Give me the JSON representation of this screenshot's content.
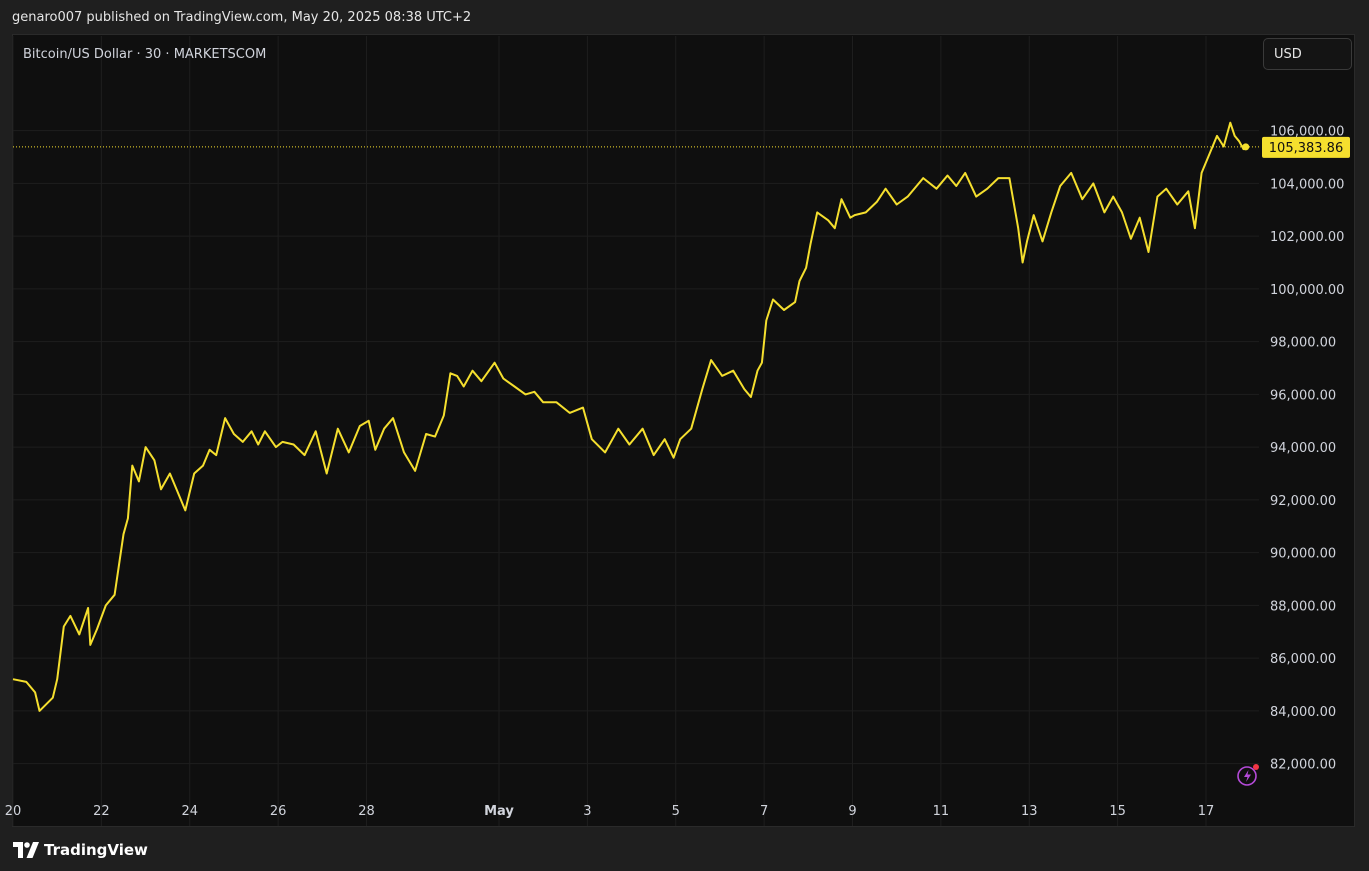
{
  "header": {
    "publish_line": "genaro007 published on TradingView.com, May 20, 2025 08:38 UTC+2"
  },
  "chart_header": {
    "symbol_line": "Bitcoin/US Dollar · 30 · MARKETSCOM"
  },
  "currency_button": {
    "label": "USD"
  },
  "footer": {
    "logo_text": "TradingView"
  },
  "colors": {
    "line": "#f5df2e",
    "background": "#0f0f0f",
    "grid": "#1e1e1e",
    "axis_text": "#d1d4dc"
  },
  "chart_data": {
    "type": "line",
    "title": "Bitcoin/US Dollar · 30 · MARKETSCOM",
    "xlabel": "",
    "ylabel": "",
    "grid": true,
    "x_tick_labels": [
      "20",
      "22",
      "24",
      "26",
      "28",
      "May",
      "3",
      "5",
      "7",
      "9",
      "11",
      "13",
      "15",
      "17"
    ],
    "x_tick_days": [
      20,
      22,
      24,
      26,
      28,
      31,
      33,
      35,
      37,
      39,
      41,
      43,
      45,
      47
    ],
    "y_tick_labels": [
      "82,000.00",
      "84,000.00",
      "86,000.00",
      "88,000.00",
      "90,000.00",
      "92,000.00",
      "94,000.00",
      "96,000.00",
      "98,000.00",
      "100,000.00",
      "102,000.00",
      "104,000.00",
      "106,000.00"
    ],
    "y_ticks": [
      82000,
      84000,
      86000,
      88000,
      90000,
      92000,
      94000,
      96000,
      98000,
      100000,
      102000,
      104000,
      106000
    ],
    "xlim": [
      20,
      48.2
    ],
    "ylim": [
      81000,
      108300
    ],
    "last_price": 105383.86,
    "last_price_label": "105,383.86",
    "series": [
      {
        "x": [
          20,
          20.3,
          20.5,
          20.6,
          20.9,
          21.0,
          21.15,
          21.3,
          21.5,
          21.7,
          21.75,
          21.9,
          22.1,
          22.3,
          22.5,
          22.6,
          22.7,
          22.85,
          23.0,
          23.2,
          23.35,
          23.55,
          23.7,
          23.9,
          24.1,
          24.3,
          24.45,
          24.6,
          24.8,
          25.0,
          25.2,
          25.4,
          25.55,
          25.7,
          25.95,
          26.1,
          26.35,
          26.6,
          26.85,
          27.1,
          27.35,
          27.6,
          27.85,
          28.05,
          28.2,
          28.4,
          28.6,
          28.85,
          29.1,
          29.35,
          29.55,
          29.75,
          29.9,
          30.05,
          30.2,
          30.4,
          30.6,
          30.9,
          31.1,
          31.35,
          31.6,
          31.8,
          32.0,
          32.3,
          32.6,
          32.9,
          33.1,
          33.4,
          33.7,
          33.95,
          34.25,
          34.5,
          34.75,
          34.95,
          35.1,
          35.35,
          35.6,
          35.8,
          36.05,
          36.3,
          36.55,
          36.7,
          36.85,
          36.95,
          37.05,
          37.2,
          37.45,
          37.7,
          37.8,
          37.95,
          38.05,
          38.2,
          38.45,
          38.6,
          38.75,
          38.95,
          39.05,
          39.3,
          39.55,
          39.75,
          40.0,
          40.25,
          40.6,
          40.9,
          41.15,
          41.35,
          41.55,
          41.8,
          42.05,
          42.3,
          42.55,
          42.75,
          42.85,
          42.95,
          43.1,
          43.3,
          43.5,
          43.7,
          43.95,
          44.2,
          44.45,
          44.7,
          44.9,
          45.1,
          45.3,
          45.5,
          45.7,
          45.9,
          46.1,
          46.35,
          46.6,
          46.75,
          46.9,
          47.1,
          47.25,
          47.4,
          47.55,
          47.65,
          47.75,
          47.85,
          47.9
        ],
        "y": [
          85200,
          85100,
          84700,
          84000,
          84500,
          85200,
          87200,
          87600,
          86900,
          87900,
          86500,
          87100,
          88000,
          88400,
          90700,
          91300,
          93300,
          92700,
          94000,
          93500,
          92400,
          93000,
          92400,
          91600,
          93000,
          93300,
          93900,
          93700,
          95100,
          94500,
          94200,
          94600,
          94100,
          94600,
          94000,
          94200,
          94100,
          93700,
          94600,
          93000,
          94700,
          93800,
          94800,
          95000,
          93900,
          94700,
          95100,
          93800,
          93100,
          94500,
          94400,
          95200,
          96800,
          96700,
          96300,
          96900,
          96500,
          97200,
          96600,
          96300,
          96000,
          96100,
          95700,
          95700,
          95300,
          95500,
          94300,
          93800,
          94700,
          94100,
          94700,
          93700,
          94300,
          93600,
          94300,
          94700,
          96200,
          97300,
          96700,
          96900,
          96200,
          95900,
          96900,
          97200,
          98800,
          99600,
          99200,
          99500,
          100300,
          100800,
          101700,
          102900,
          102600,
          102300,
          103400,
          102700,
          102800,
          102900,
          103300,
          103800,
          103200,
          103500,
          104200,
          103800,
          104300,
          103900,
          104400,
          103500,
          103800,
          104200,
          104200,
          102300,
          101000,
          101800,
          102800,
          101800,
          102900,
          103900,
          104400,
          103400,
          104000,
          102900,
          103500,
          102900,
          101900,
          102700,
          101400,
          103500,
          103800,
          103200,
          103700,
          102300,
          104400,
          105200,
          105800,
          105400,
          106300,
          105800,
          105600,
          105300,
          105384
        ]
      }
    ]
  }
}
